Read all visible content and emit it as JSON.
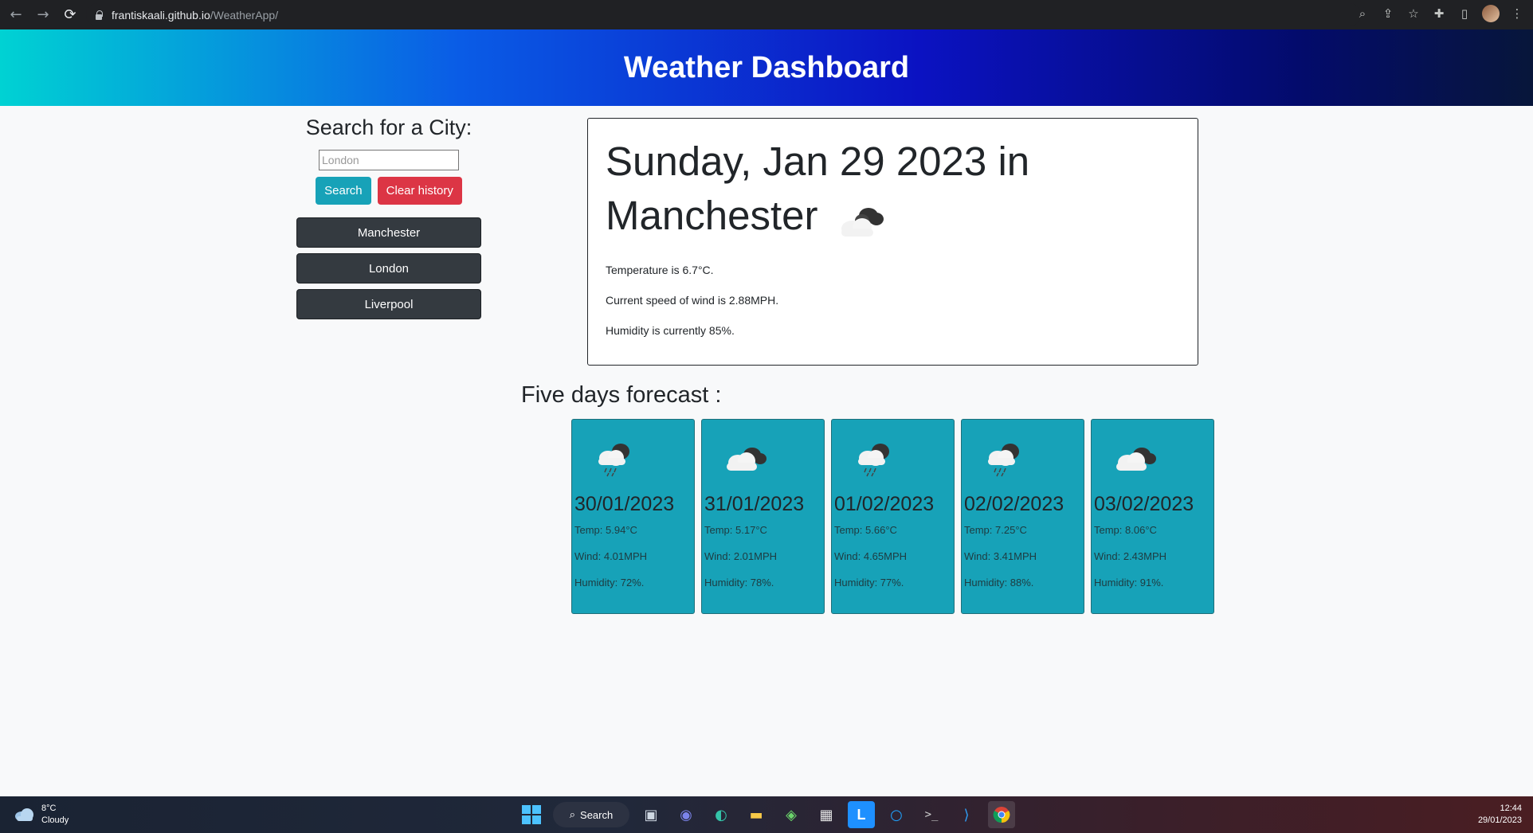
{
  "browser": {
    "url_host": "frantiskaali.github.io",
    "url_path": "/WeatherApp/"
  },
  "header": {
    "title": "Weather Dashboard"
  },
  "sidebar": {
    "title": "Search for a City:",
    "search_placeholder": "London",
    "search_label": "Search",
    "clear_label": "Clear history",
    "history": [
      {
        "label": "Manchester"
      },
      {
        "label": "London"
      },
      {
        "label": "Liverpool"
      }
    ]
  },
  "current": {
    "heading": "Sunday, Jan 29 2023 in Manchester",
    "temperature": "Temperature is 6.7°C.",
    "wind": "Current speed of wind is 2.88MPH.",
    "humidity": "Humidity is currently 85%.",
    "icon": "cloudy-icon"
  },
  "forecast": {
    "title": "Five days forecast :",
    "days": [
      {
        "date": "30/01/2023",
        "temp": "Temp: 5.94°C",
        "wind": "Wind: 4.01MPH",
        "humidity": "Humidity: 72%.",
        "icon": "rain-cloud-icon"
      },
      {
        "date": "31/01/2023",
        "temp": "Temp: 5.17°C",
        "wind": "Wind: 2.01MPH",
        "humidity": "Humidity: 78%.",
        "icon": "cloudy-icon"
      },
      {
        "date": "01/02/2023",
        "temp": "Temp: 5.66°C",
        "wind": "Wind: 4.65MPH",
        "humidity": "Humidity: 77%.",
        "icon": "rain-cloud-icon"
      },
      {
        "date": "02/02/2023",
        "temp": "Temp: 7.25°C",
        "wind": "Wind: 3.41MPH",
        "humidity": "Humidity: 88%.",
        "icon": "rain-cloud-icon"
      },
      {
        "date": "03/02/2023",
        "temp": "Temp: 8.06°C",
        "wind": "Wind: 2.43MPH",
        "humidity": "Humidity: 91%.",
        "icon": "cloudy-icon"
      }
    ]
  },
  "taskbar": {
    "weather_temp": "8°C",
    "weather_desc": "Cloudy",
    "search_label": "Search",
    "time": "12:44",
    "date": "29/01/2023"
  },
  "colors": {
    "accent_teal": "#17a2b8",
    "danger": "#dc3545",
    "dark_button": "#343a40"
  }
}
